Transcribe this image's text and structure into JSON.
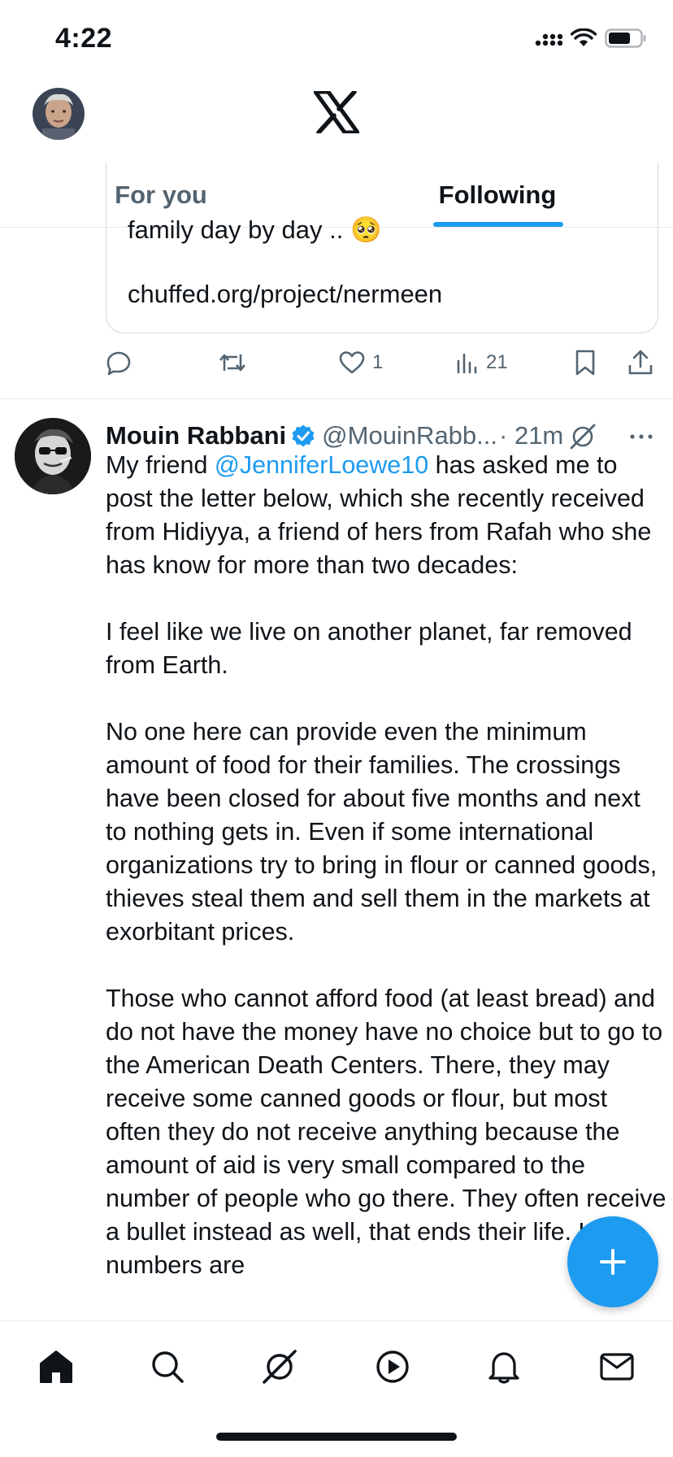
{
  "status_bar": {
    "time": "4:22"
  },
  "header": {
    "logo": "x-logo",
    "tabs": [
      {
        "label": "For you",
        "active": false
      },
      {
        "label": "Following",
        "active": true
      }
    ]
  },
  "previous_tweet": {
    "card_line1": "family day by day .. 🥺",
    "card_line2": "chuffed.org/project/nermeen",
    "likes": "1",
    "views": "21"
  },
  "tweet": {
    "author_name": "Mouin Rabbani",
    "handle": "@MouinRabb...",
    "time": "· 21m",
    "verified": true,
    "paragraph1_pre": "My friend ",
    "mention": "@JenniferLoewe10",
    "paragraph1_post": " has asked me to post the letter below, which she recently received from Hidiyya, a friend of hers from Rafah who she has know for more than two decades:",
    "paragraph2": "I feel like we live on another planet, far removed from Earth.",
    "paragraph3": "No one here can provide even the minimum amount of food for their families. The crossings have been closed for about five months and next to nothing gets in. Even if some international organizations try to bring in flour or canned goods, thieves steal them and sell them in the markets at exorbitant prices.",
    "paragraph4": "Those who cannot afford food (at least bread) and do not have the money have no choice but to go to the American Death Centers. There, they may receive some canned goods or flour, but most often they do not receive anything because the amount of aid is very small compared to the number of people who go there. They often receive a bullet instead as well, that ends their life. Large numbers are"
  },
  "colors": {
    "accent": "#1d9bf0",
    "text": "#0f1419",
    "secondary": "#536471"
  },
  "bottom_nav": [
    "home-icon",
    "search-icon",
    "grok-icon",
    "video-icon",
    "bell-icon",
    "mail-icon"
  ]
}
